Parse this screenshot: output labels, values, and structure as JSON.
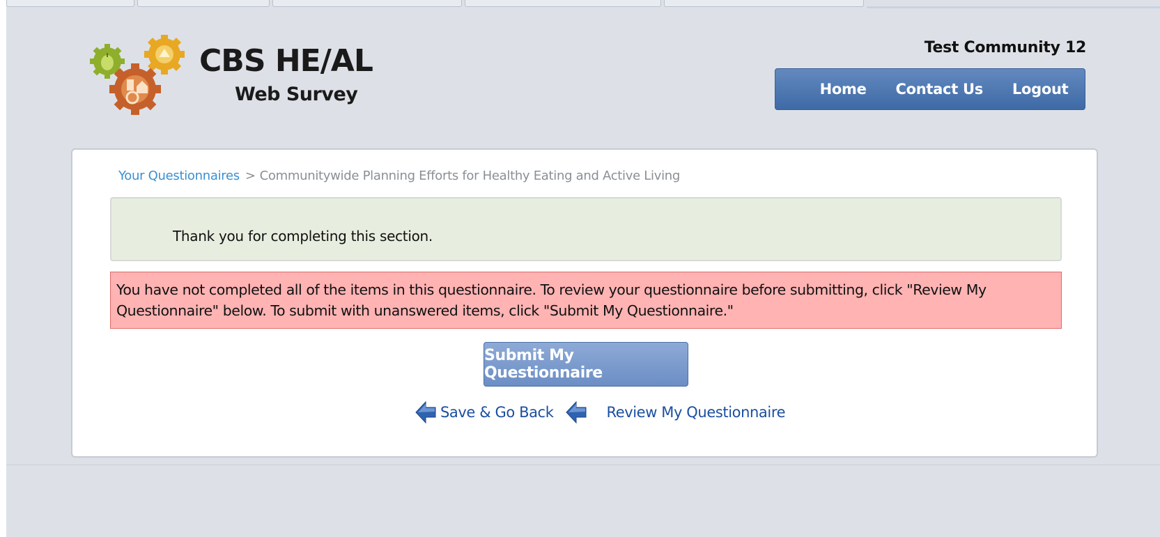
{
  "header": {
    "title_main": "CBS HE/AL",
    "title_sub": "Web Survey",
    "community": "Test Community 12",
    "logo_icon": "gears-logo-icon"
  },
  "nav": {
    "items": [
      {
        "label": "Home"
      },
      {
        "label": "Contact Us"
      },
      {
        "label": "Logout"
      }
    ]
  },
  "breadcrumb": {
    "link": "Your Questionnaires",
    "separator": ">",
    "current": "Communitywide Planning Efforts for Healthy Eating and Active Living"
  },
  "messages": {
    "thanks": "Thank you for completing this section.",
    "warning": "You have not completed all of the items in this questionnaire. To review your questionnaire before submitting, click \"Review My Questionnaire\" below. To submit with unanswered items, click \"Submit My Questionnaire.\""
  },
  "actions": {
    "submit": "Submit My Questionnaire",
    "save_back": "Save & Go Back",
    "review": "Review My Questionnaire"
  },
  "colors": {
    "nav_bg": "#4a72ad",
    "warning_bg": "#ffb3b3",
    "thanks_bg": "#e8eedf",
    "link": "#3a8fd0"
  }
}
